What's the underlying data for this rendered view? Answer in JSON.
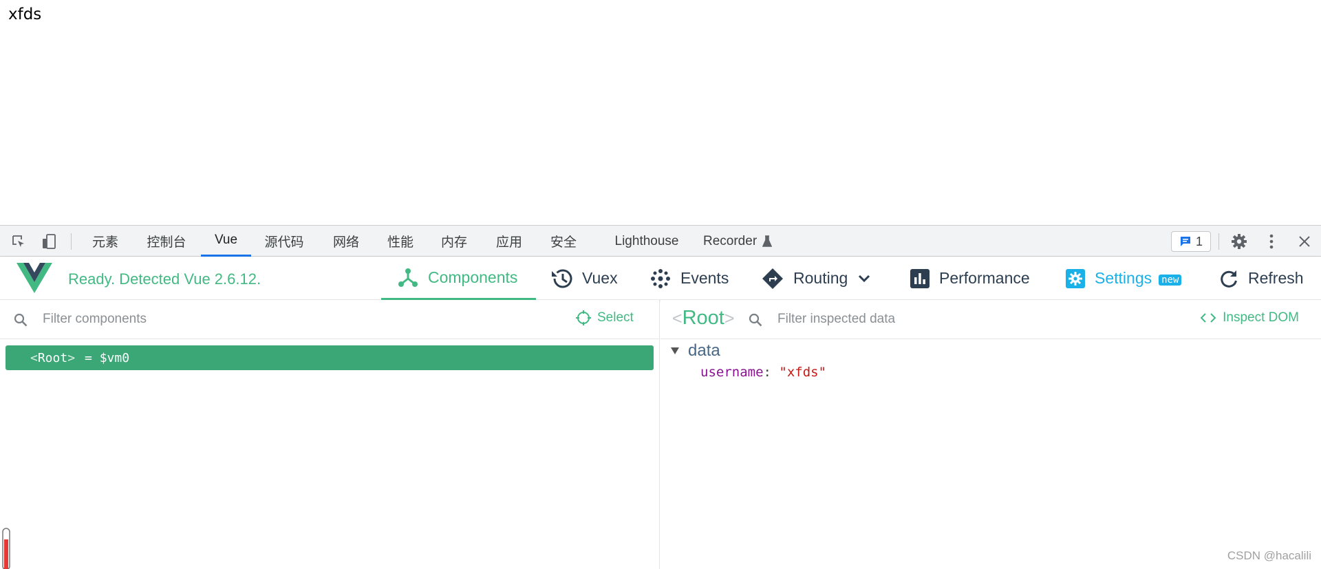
{
  "page": {
    "text": "xfds"
  },
  "devtools": {
    "tabs": [
      "元素",
      "控制台",
      "Vue",
      "源代码",
      "网络",
      "性能",
      "内存",
      "应用",
      "安全",
      "Lighthouse",
      "Recorder"
    ],
    "active_tab": "Vue",
    "message_count": "1"
  },
  "vue": {
    "status": "Ready. Detected Vue 2.6.12.",
    "nav": {
      "components": "Components",
      "vuex": "Vuex",
      "events": "Events",
      "routing": "Routing",
      "performance": "Performance",
      "settings": "Settings",
      "settings_badge": "new",
      "refresh": "Refresh"
    },
    "colors": {
      "accent": "#42b983",
      "selected_row": "#3ba776",
      "settings": "#1ab0e8",
      "dark": "#2c3e50"
    }
  },
  "left_pane": {
    "filter_placeholder": "Filter components",
    "select_label": "Select",
    "tree": [
      {
        "open": "<",
        "name": "Root",
        "close": ">",
        "suffix": "= $vm0"
      }
    ]
  },
  "right_pane": {
    "title_open": "<",
    "title_name": "Root",
    "title_close": ">",
    "filter_placeholder": "Filter inspected data",
    "inspect_dom_label": "Inspect DOM",
    "section": "data",
    "fields": [
      {
        "key": "username",
        "value": "\"xfds\""
      }
    ]
  },
  "watermark": "CSDN @hacalili"
}
